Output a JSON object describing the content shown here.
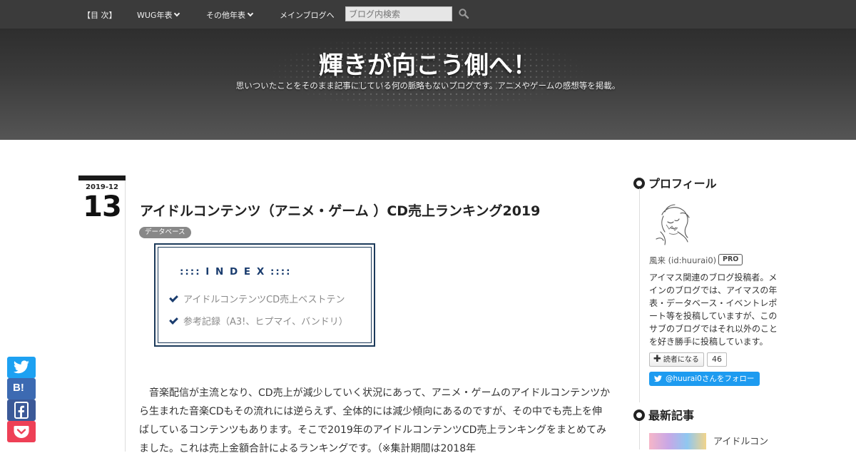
{
  "nav": {
    "items": [
      "【目 次】",
      "WUG年表",
      "その他年表",
      "メインブログへ"
    ],
    "search_placeholder": "ブログ内検索"
  },
  "header": {
    "title": "輝きが向こう側へ！",
    "description": "思いついたことをそのまま記事にしている何の脈略もないブログです。アニメやゲームの感想等を掲載。"
  },
  "entry": {
    "date_ym": "2019-12",
    "date_day": "13",
    "title": "アイドルコンテンツ（アニメ・ゲーム ）CD売上ランキング2019",
    "category": "データベース",
    "toc_title": ":::: I N D E X ::::",
    "toc_items": [
      "アイドルコンテンツCD売上ベストテン",
      "参考記録（A3!、ヒプマイ、バンドリ）"
    ],
    "body": "　音楽配信が主流となり、CD売上が減少していく状況にあって、アニメ・ゲームのアイドルコンテンツから生まれた音楽CDもその流れには逆らえず、全体的には減少傾向にあるのですが、その中でも売上を伸ばしているコンテンツもあります。そこで2019年のアイドルコンテンツCD売上ランキングをまとめてみました。これは売上金額合計によるランキングです。（※集計期間は2018年"
  },
  "share": {
    "hatena_label": "B!"
  },
  "sidebar": {
    "profile_heading": "プロフィール",
    "profile_id": "風来 (id:huurai0)",
    "pro_badge": "PRO",
    "profile_text": "アイマス関連のブログ投稿者。メインのブログでは、アイマスの年表・データベース・イベントレポート等を投稿していますが、このサブのブログではそれ以外のことを好き勝手に投稿しています。",
    "reader_button": "読者になる",
    "reader_count": "46",
    "follow_button": "@huurai0さんをフォロー",
    "recent_heading": "最新記事",
    "recent_item": "アイドルコン"
  },
  "colors": {
    "nav_bg": "#3b3b3b",
    "toc_border": "#1c3a5a",
    "twitter": "#1da1f2",
    "hatena": "#3c6ab2",
    "facebook": "#3b5998",
    "pocket": "#ee4056"
  }
}
